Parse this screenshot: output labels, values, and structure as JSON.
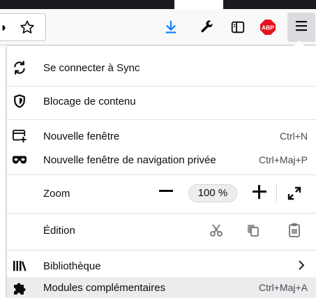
{
  "toolbar": {
    "icons": [
      "star-icon",
      "download-icon",
      "wrench-icon",
      "sidebar-icon",
      "adblock-plus-icon",
      "hamburger-menu-icon"
    ],
    "abp_label": "ABP",
    "colors": {
      "download": "#0a84ff",
      "abp": "#e6121b"
    }
  },
  "menu": {
    "sync": {
      "label": "Se connecter à Sync",
      "icon": "sync-icon"
    },
    "content_blocking": {
      "label": "Blocage de contenu",
      "icon": "shield-icon"
    },
    "new_window": {
      "label": "Nouvelle fenêtre",
      "shortcut": "Ctrl+N",
      "icon": "new-window-icon"
    },
    "private_window": {
      "label": "Nouvelle fenêtre de navigation privée",
      "shortcut": "Ctrl+Maj+P",
      "icon": "private-mask-icon"
    },
    "zoom": {
      "label": "Zoom",
      "value": "100 %"
    },
    "edit": {
      "label": "Édition",
      "icons": [
        "cut-icon",
        "copy-icon",
        "paste-icon"
      ]
    },
    "library": {
      "label": "Bibliothèque",
      "icon": "library-icon"
    },
    "addons": {
      "label": "Modules complémentaires",
      "shortcut": "Ctrl+Maj+A",
      "icon": "puzzle-icon"
    }
  }
}
